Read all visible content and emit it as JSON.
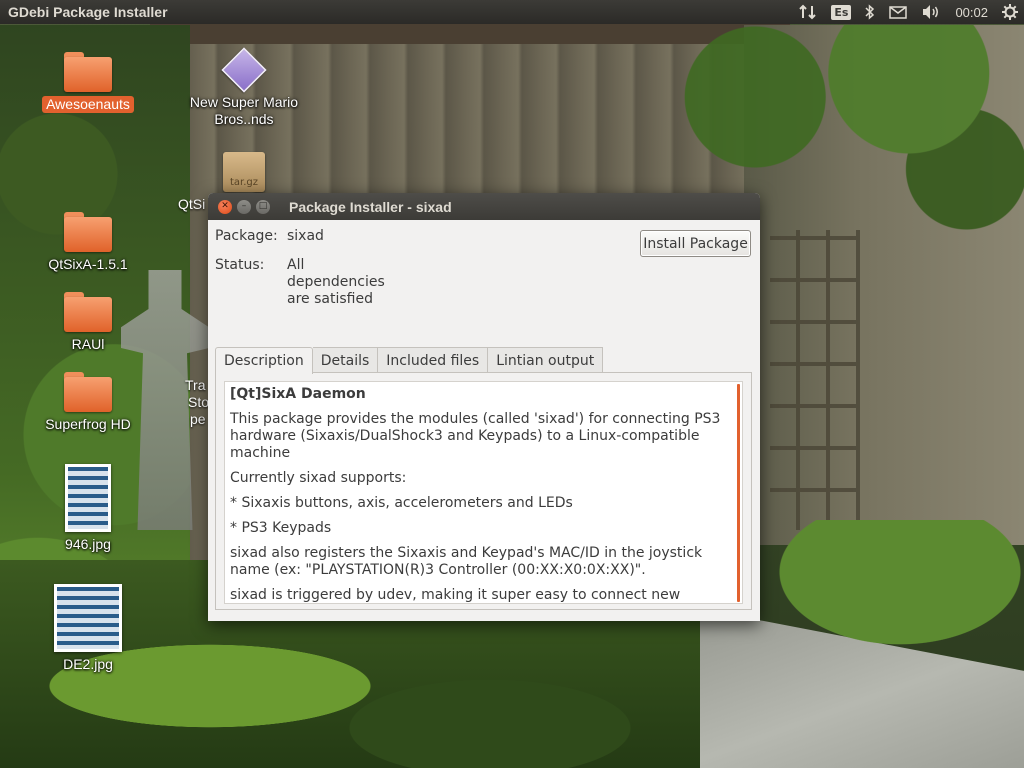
{
  "top_panel": {
    "app_title": "GDebi Package Installer",
    "keyboard_layout": "Es",
    "clock": "00:02",
    "indicator_icons": [
      "network-updown-icon",
      "keyboard-layout-icon",
      "bluetooth-icon",
      "mail-icon",
      "volume-icon",
      "session-gear-icon"
    ]
  },
  "desktop_icons": [
    {
      "name": "Awesoenauts",
      "type": "folder",
      "selected": true
    },
    {
      "name": "New Super Mario Bros..nds",
      "type": "nds-file",
      "line1": "New Super Mario",
      "line2": "Bros..nds"
    },
    {
      "name": "tar.gz",
      "type": "archive",
      "badge": "tar.gz"
    },
    {
      "name": "QtSixA-1.5.1",
      "type": "folder"
    },
    {
      "name": "RAUl",
      "type": "folder"
    },
    {
      "name": "Superfrog HD",
      "type": "folder"
    },
    {
      "name": "946.jpg",
      "type": "image"
    },
    {
      "name": "DE2.jpg",
      "type": "image"
    }
  ],
  "partial_labels": {
    "qtsi": "QtSi",
    "tra": "Tra",
    "sto": "Sto",
    "pe": "pe"
  },
  "window": {
    "title": "Package Installer - sixad",
    "package_label": "Package:",
    "package_value": "sixad",
    "status_label": "Status:",
    "status_lines": [
      "All",
      "dependencies",
      "are satisfied"
    ],
    "install_button": "Install Package",
    "tabs": [
      {
        "label": "Description",
        "active": true
      },
      {
        "label": "Details",
        "active": false
      },
      {
        "label": "Included files",
        "active": false
      },
      {
        "label": "Lintian output",
        "active": false
      }
    ],
    "description": {
      "heading": "[Qt]SixA Daemon",
      "paragraphs": [
        "This package provides the modules (called 'sixad') for connecting PS3 hardware (Sixaxis/DualShock3 and Keypads) to a Linux-compatible machine",
        "Currently sixad supports:",
        "* Sixaxis buttons, axis, accelerometers and LEDs",
        "* PS3 Keypads",
        "sixad also registers the Sixaxis and Keypad's MAC/ID in the joystick name (ex: \"PLAYSTATION(R)3 Controller (00:XX:X0:0X:XX)\".",
        "sixad is triggered by udev, making it super easy to connect new devices (you just need to press the PS button)"
      ]
    }
  },
  "colors": {
    "accent": "#e2612e",
    "panel": "#3c3b37",
    "window_bg": "#f2f1f0"
  }
}
